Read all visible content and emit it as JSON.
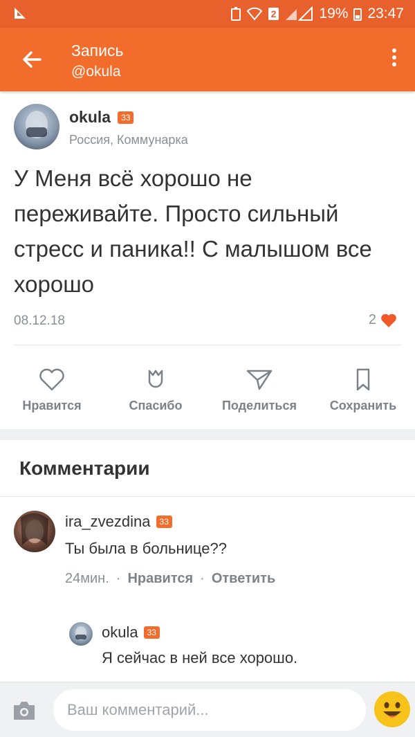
{
  "status_bar": {
    "left_icon": "app-notification-icon",
    "badge": "2",
    "battery": "19%",
    "time": "23:47"
  },
  "appbar": {
    "title": "Запись",
    "subtitle": "@okula"
  },
  "post": {
    "author": "okula",
    "age_badge": "33",
    "location": "Россия, Коммунарка",
    "text": "У Меня всё хорошо не переживайте. Просто сильный стресс и паника!! С малышом все хорошо",
    "date": "08.12.18",
    "likes": "2"
  },
  "actions": [
    {
      "label": "Нравится",
      "icon": "heart-outline-icon"
    },
    {
      "label": "Спасибо",
      "icon": "tulip-icon"
    },
    {
      "label": "Поделиться",
      "icon": "share-icon"
    },
    {
      "label": "Сохранить",
      "icon": "bookmark-icon"
    }
  ],
  "comments": {
    "title": "Комментарии",
    "items": [
      {
        "author": "ira_zvezdina",
        "age_badge": "33",
        "text": "Ты была в больнице??",
        "time": "24мин.",
        "like": "Нравится",
        "reply": "Ответить"
      },
      {
        "author": "okula",
        "age_badge": "33",
        "text": "Я сейчас в ней все хорошо."
      }
    ]
  },
  "input": {
    "placeholder": "Ваш комментарий..."
  },
  "colors": {
    "brand": "#f26d2b",
    "status_bar": "#e8602b",
    "heart": "#f05a2a"
  }
}
